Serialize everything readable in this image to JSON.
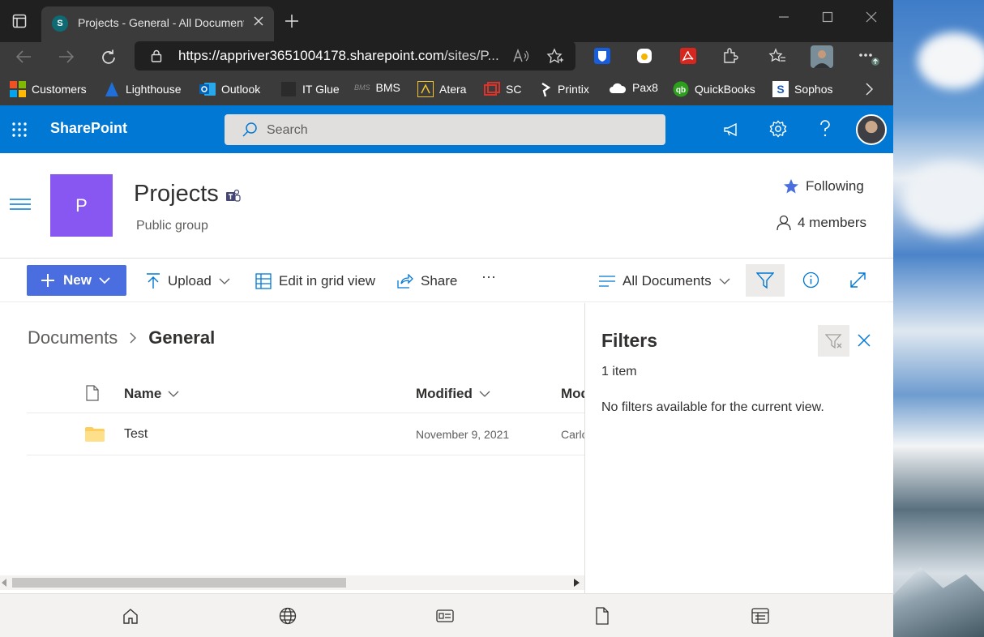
{
  "browser": {
    "tab_title": "Projects - General - All Documents",
    "tab_favicon_letter": "S",
    "url_host": "https://appriver3651004178.sharepoint.com",
    "url_path": "/sites/P...",
    "favorites": [
      {
        "label": "Customers",
        "color": "#f25022"
      },
      {
        "label": "Lighthouse",
        "color": "#1e6fd9"
      },
      {
        "label": "Outlook",
        "color": "#0364b8"
      },
      {
        "label": "IT Glue",
        "color": "#2b2b2b"
      },
      {
        "label": "BMS",
        "color": "#5a5a5a"
      },
      {
        "label": "Atera",
        "color": "#f2c230"
      },
      {
        "label": "SC",
        "color": "#d9342b"
      },
      {
        "label": "Printix",
        "color": "#ffffff"
      },
      {
        "label": "Pax8",
        "color": "#ffffff"
      },
      {
        "label": "QuickBooks",
        "color": "#2ca01c"
      },
      {
        "label": "Sophos",
        "color": "#1e5bbf"
      }
    ]
  },
  "suite": {
    "brand": "SharePoint",
    "search_placeholder": "Search",
    "accent": "#0078d4"
  },
  "site": {
    "logo_letter": "P",
    "title": "Projects",
    "subtitle": "Public group",
    "following": "Following",
    "members": "4 members",
    "logo_color": "#8857f1"
  },
  "commands": {
    "new": "New",
    "upload": "Upload",
    "grid": "Edit in grid view",
    "share": "Share",
    "more": "···",
    "view": "All Documents"
  },
  "content": {
    "breadcrumb_root": "Documents",
    "breadcrumb_current": "General",
    "columns": {
      "name": "Name",
      "modified": "Modified",
      "modified_by": "Modi"
    },
    "rows": [
      {
        "name": "Test",
        "modified": "November 9, 2021",
        "modified_by": "Carlo"
      }
    ]
  },
  "filters": {
    "title": "Filters",
    "count": "1 item",
    "empty": "No filters available for the current view."
  }
}
